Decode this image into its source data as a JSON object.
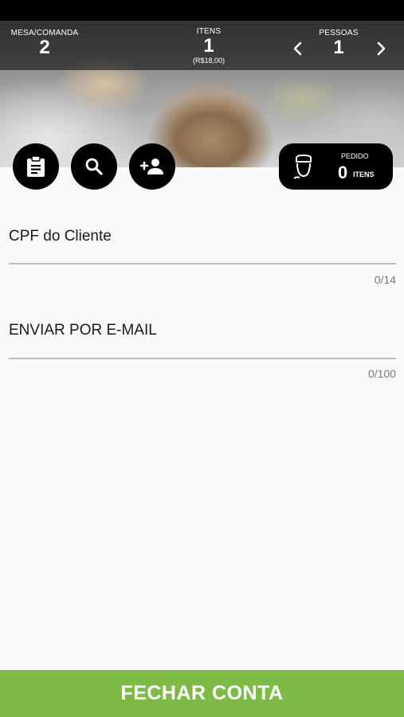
{
  "header": {
    "mesa": {
      "label": "MESA/COMANDA",
      "value": "2"
    },
    "itens": {
      "label": "ITENS",
      "value": "1",
      "total": "(R$18,00)"
    },
    "pessoas": {
      "label": "PESSOAS",
      "value": "1"
    }
  },
  "actions": {
    "clipboard_icon": "clipboard-icon",
    "search_icon": "search-icon",
    "add_person_icon": "person-add-icon"
  },
  "pedido": {
    "label": "PEDIDO",
    "count": "0",
    "unit": "ITENS",
    "icon": "waiter-icon"
  },
  "form": {
    "cpf": {
      "label": "CPF do Cliente",
      "counter": "0/14"
    },
    "email": {
      "label": "ENVIAR POR E-MAIL",
      "counter": "0/100"
    }
  },
  "footer": {
    "button_label": "FECHAR CONTA"
  },
  "colors": {
    "accent": "#7dbb46",
    "dark": "#000000",
    "background": "#fafafa"
  }
}
